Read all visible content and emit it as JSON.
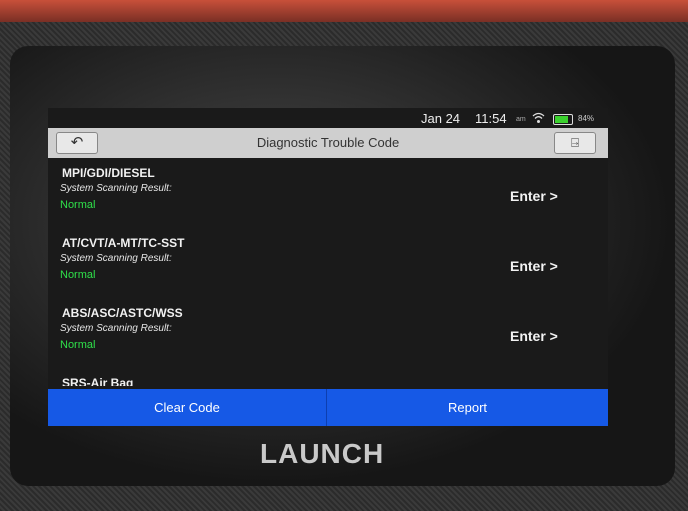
{
  "status_bar": {
    "date": "Jan 24",
    "time": "11:54",
    "signal_text": "am",
    "battery_percent": "84%",
    "battery_level": 0.84,
    "battery_color": "#3bd12e"
  },
  "header": {
    "back_icon": "back-arrow-icon",
    "title": "Diagnostic Trouble Code",
    "exit_icon": "exit-icon"
  },
  "systems": [
    {
      "name": "MPI/GDI/DIESEL",
      "scan_label": "System Scanning Result:",
      "status": "Normal",
      "action": "Enter >"
    },
    {
      "name": "AT/CVT/A-MT/TC-SST",
      "scan_label": "System Scanning Result:",
      "status": "Normal",
      "action": "Enter >"
    },
    {
      "name": "ABS/ASC/ASTC/WSS",
      "scan_label": "System Scanning Result:",
      "status": "Normal",
      "action": "Enter >"
    },
    {
      "name": "SRS-Air Bag",
      "scan_label": "",
      "status": "",
      "action": ""
    }
  ],
  "footer": {
    "clear_label": "Clear Code",
    "report_label": "Report",
    "accent_color": "#1659e6"
  },
  "device": {
    "brand": "LAUNCH"
  }
}
